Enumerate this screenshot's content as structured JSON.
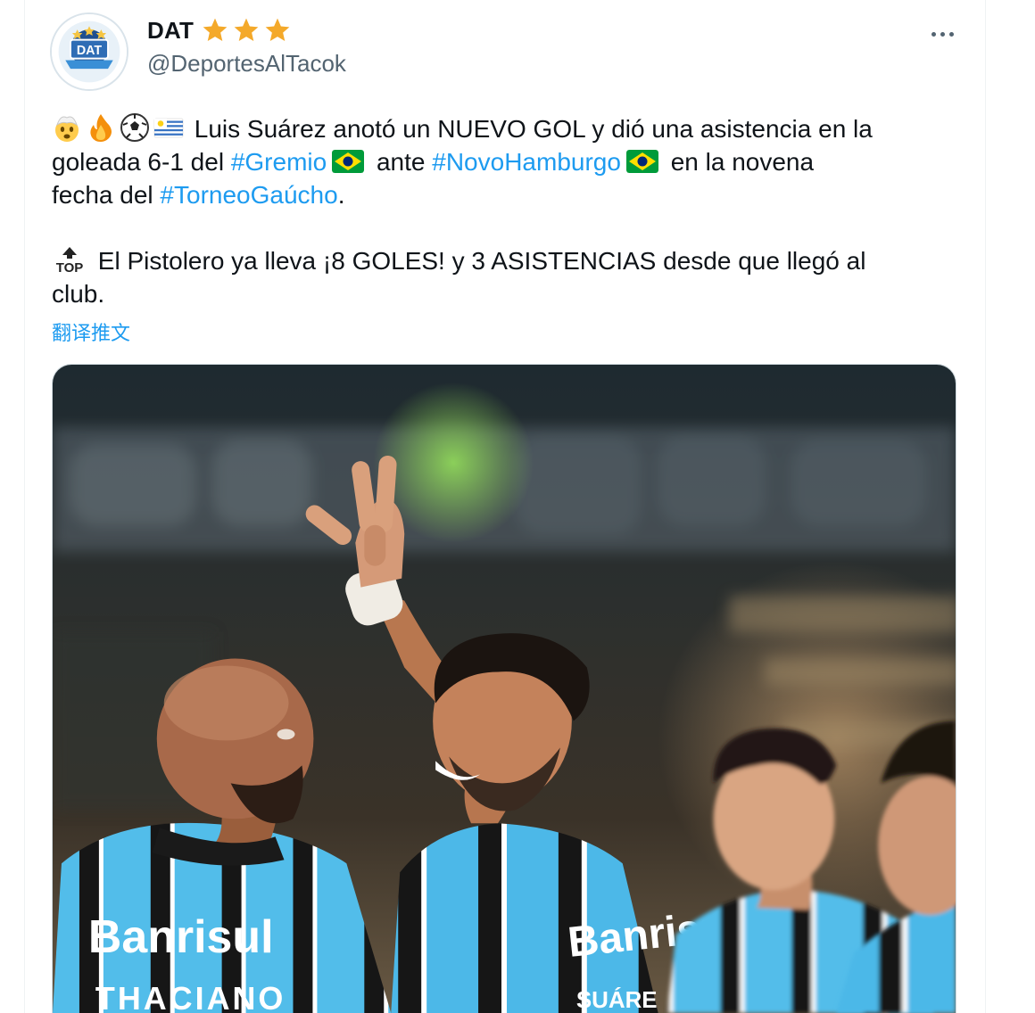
{
  "tweet": {
    "author": {
      "display_name": "DAT",
      "handle": "@DeportesAlTacok",
      "badge_stars": 3,
      "avatar_text": "DAT"
    },
    "more_menu_icon": "more-horizontal-icon",
    "text": {
      "line1_rest": " Luis Suárez anotó un NUEVO GOL y dió una asistencia en la",
      "line2_a": "goleada 6-1 del ",
      "hashtag_gremio": "#Gremio",
      "line2_b": " ante ",
      "hashtag_novo": "#NovoHamburgo",
      "line2_c": " en la novena",
      "line3_a": "fecha del ",
      "hashtag_torneo": "#TorneoGaúcho",
      "line3_b": ".",
      "top_label": "TOP",
      "line4": " El Pistolero ya lleva ¡8 GOLES! y 3 ASISTENCIAS desde que llegó al",
      "line5": "club."
    },
    "translate_label": "翻译推文",
    "media": {
      "kind": "photo",
      "jersey_sponsor_left": "Banrisul",
      "jersey_name_left": "THACIANO",
      "jersey_sponsor_center": "Banrisu",
      "jersey_name_center": "SUÁRE",
      "colors": {
        "sky_blue": "#49b6e6",
        "black_stripe": "#1a1a1a",
        "skin": "#c98a63"
      }
    }
  },
  "colors": {
    "link": "#1d9bf0",
    "text": "#0f1419",
    "muted": "#536471",
    "star": "#f4a92a"
  }
}
